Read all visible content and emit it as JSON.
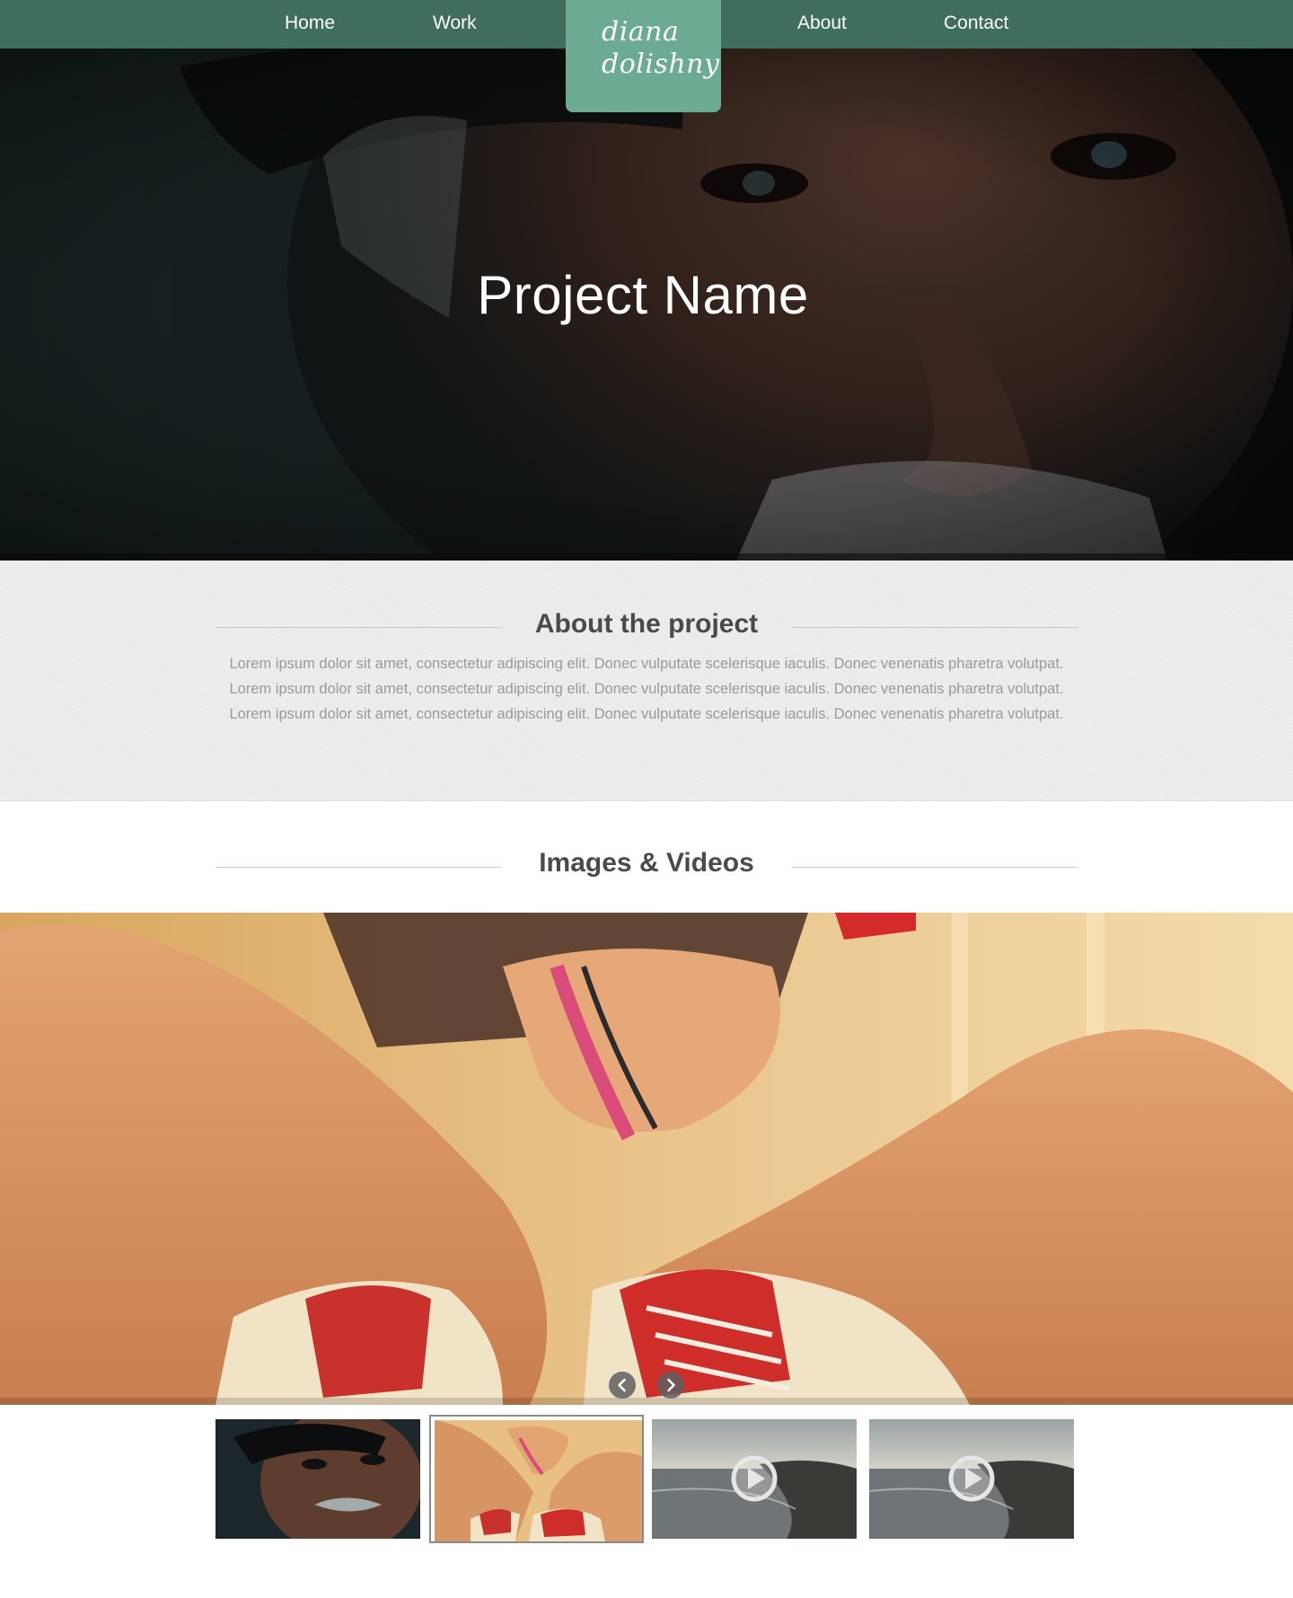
{
  "nav": {
    "items": [
      {
        "label": "Home"
      },
      {
        "label": "Work"
      },
      {
        "label": "About"
      },
      {
        "label": "Contact"
      }
    ],
    "logo": {
      "line1": "diana",
      "line2": "dolishny"
    }
  },
  "hero": {
    "title": "Project Name"
  },
  "about": {
    "title": "About the project",
    "body": "Lorem ipsum dolor sit amet, consectetur adipiscing elit. Donec vulputate scelerisque iaculis. Donec venenatis pharetra volutpat. Lorem ipsum dolor sit amet, consectetur adipiscing elit. Donec vulputate scelerisque iaculis. Donec venenatis pharetra volutpat. Lorem ipsum dolor sit amet, consectetur adipiscing elit. Donec vulputate scelerisque iaculis. Donec venenatis pharetra volutpat."
  },
  "media": {
    "title": "Images & Videos",
    "slider": {
      "prev_icon": "chevron-left-icon",
      "next_icon": "chevron-right-icon"
    },
    "thumbnails": [
      {
        "kind": "image",
        "subject": "portrait of elderly man"
      },
      {
        "kind": "image",
        "subject": "sneakers",
        "selected": true
      },
      {
        "kind": "video",
        "subject": "coastline",
        "icon": "play-icon"
      },
      {
        "kind": "video",
        "subject": "coastline",
        "icon": "play-icon"
      }
    ]
  },
  "colors": {
    "nav_bg": "#3f6e5d",
    "logo_bg": "#6aab91",
    "about_bg": "#ededed",
    "heading": "#4a4a4a",
    "body_text": "#9a9a9a"
  }
}
